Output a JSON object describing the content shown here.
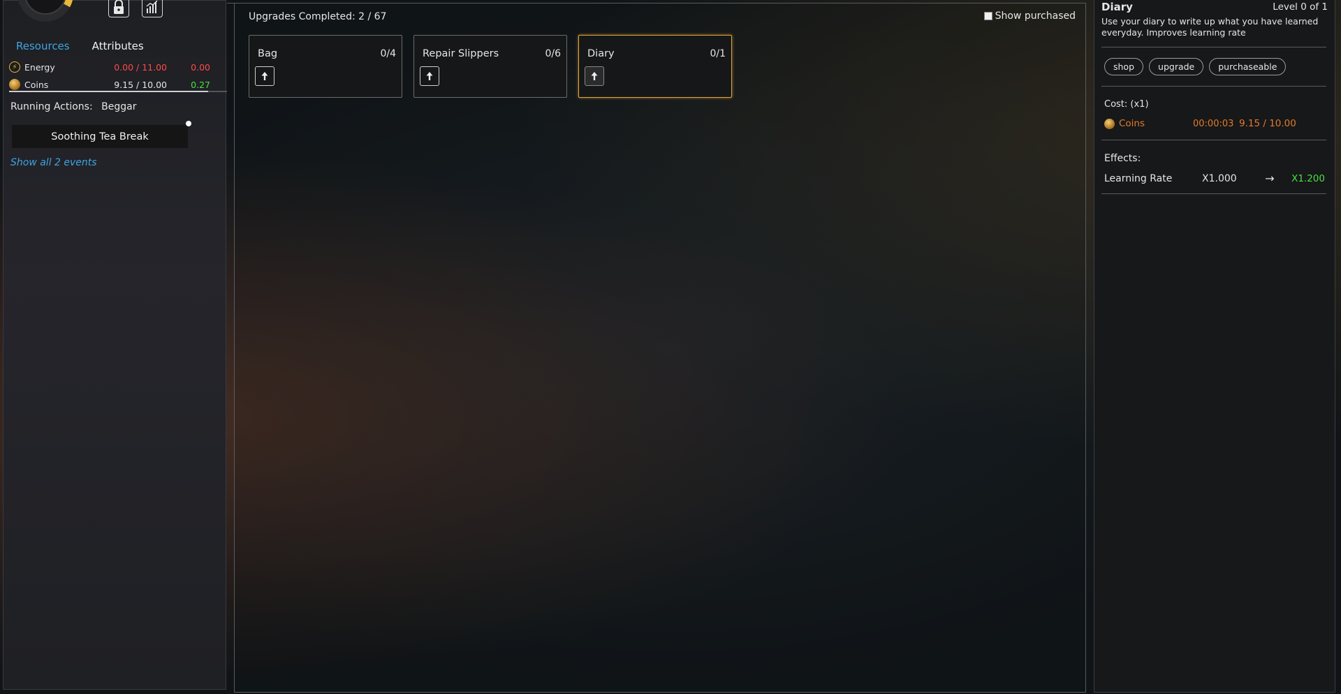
{
  "sidebar": {
    "tabs": {
      "resources": "Resources",
      "attributes": "Attributes"
    },
    "resources": [
      {
        "name": "Energy",
        "value": "0.00 / 11.00",
        "rate": "0.00",
        "icon": "lightning-icon"
      },
      {
        "name": "Coins",
        "value": "9.15 / 10.00",
        "rate": "0.27",
        "icon": "coin-icon"
      }
    ],
    "coins_progress": 0.915,
    "running_label": "Running Actions:",
    "running_value": "Beggar",
    "event_button": "Soothing Tea  Break",
    "show_events": "Show all 2 events",
    "icons": [
      "lock-icon",
      "stats-chart-icon"
    ],
    "avatar_progress": 0.33
  },
  "upgrades": {
    "completed_label": "Upgrades Completed: 2 / 67",
    "show_purchased_label": "Show purchased",
    "cards": [
      {
        "title": "Bag",
        "count": "0/4"
      },
      {
        "title": "Repair Slippers",
        "count": "0/6"
      },
      {
        "title": "Diary",
        "count": "0/1"
      }
    ]
  },
  "details": {
    "title": "Diary",
    "level": "Level 0 of 1",
    "description": "Use your diary to write up what you have learned everyday. Improves learning rate",
    "tags": [
      "shop",
      "upgrade",
      "purchaseable"
    ],
    "cost_label": "Cost: (x1)",
    "cost": {
      "name": "Coins",
      "time": "00:00:03",
      "amount": "9.15 / 10.00"
    },
    "effects_label": "Effects:",
    "effect": {
      "name": "Learning Rate",
      "from": "X1.000",
      "arrow": "→",
      "to": "X1.200"
    }
  },
  "colors": {
    "accent_blue": "#3fa4e0",
    "negative_red": "#ff4b4b",
    "positive_green": "#48e043",
    "cost_orange": "#e07b2c",
    "selected_border": "#e0a640"
  }
}
